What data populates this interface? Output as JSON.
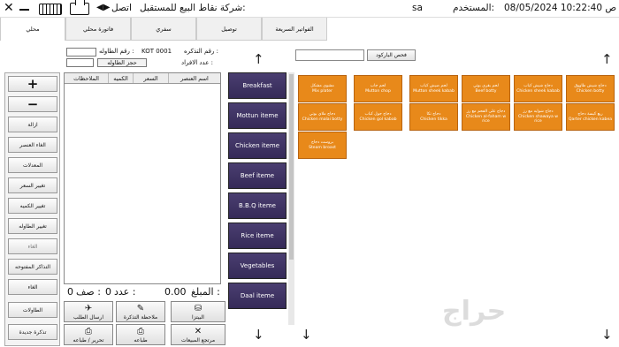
{
  "titlebar": {
    "company": "شركة نقاط البيع للمستقبل:",
    "connection": "اتصل",
    "user_label": "المستخدم:",
    "user_value": "sa",
    "datetime": "08/05/2024 10:22:40 ص",
    "close_glyph": "✕",
    "arrow_glyph": "◀▶"
  },
  "tabs": [
    {
      "label": "محلي"
    },
    {
      "label": "فاتورة محلي"
    },
    {
      "label": "سفري"
    },
    {
      "label": "توصيل"
    },
    {
      "label": "الفواتير السريعة"
    }
  ],
  "order": {
    "ticket_label": "رقم التذكره :",
    "ticket_value": "KOT 0001",
    "table_label": "رقم الطاوله :",
    "persons_label": "عدد الافراد :",
    "reserve_table": "حجز الطاوله"
  },
  "grid": {
    "columns": [
      "الملاحظات",
      "الكميه",
      "السعر",
      "اسم العنصر"
    ]
  },
  "summary": {
    "amount_label": "المبلغ :",
    "amount_value": "0.00",
    "count_label": "عدد :",
    "count_value": "0",
    "row_label": "صف :",
    "row_value": "0"
  },
  "left_buttons": [
    {
      "label": "+"
    },
    {
      "label": "−"
    },
    {
      "label": "ازالة"
    },
    {
      "label": "الغاء العنصر"
    },
    {
      "label": "المعدلات"
    },
    {
      "label": "تغيير السعر"
    },
    {
      "label": "تغيير الكميه"
    },
    {
      "label": "تغيير الطاوله"
    },
    {
      "label": "الغاء"
    },
    {
      "label": "التذاكر المفتوحه"
    },
    {
      "label": "الغاء"
    },
    {
      "label": "الطاولات"
    },
    {
      "label": "تذكرة جديدة"
    }
  ],
  "bottom_buttons": {
    "send_order": "ارسال الطلب",
    "ticket_note": "ملاحظة التذكرة",
    "pizza": "البيتزا",
    "edit_print": "تحرير / طباعه",
    "print": "طباعه",
    "sales_return": "مرتجع المبيعات"
  },
  "categories": [
    {
      "label": "Breakfast"
    },
    {
      "label": "Mottun iteme"
    },
    {
      "label": "Chicken iteme"
    },
    {
      "label": "Beef iteme"
    },
    {
      "label": "B.B.Q iteme"
    },
    {
      "label": "Rice iteme"
    },
    {
      "label": "Vegetables"
    },
    {
      "label": "Daal iteme"
    }
  ],
  "search": {
    "placeholder": "",
    "barcode_button": "فحص الباركود"
  },
  "items": [
    {
      "ar": "دجاج شيش طاووق",
      "en": "Chicken botty"
    },
    {
      "ar": "دجاج شيش كباب",
      "en": "Chicken sheek kabab"
    },
    {
      "ar": "لحم بقري بوتي",
      "en": "Beef botty"
    },
    {
      "ar": "لحم ضيش كباب",
      "en": "Mutton sheek kabab"
    },
    {
      "ar": "لحم جاب",
      "en": "Mutton chop"
    },
    {
      "ar": "مشوي مشكل",
      "en": "Mix plater"
    },
    {
      "ar": "ربع كيسة دجاج",
      "en": "Qarter chicken kabea"
    },
    {
      "ar": "دجاج شوايه مع رز",
      "en": "Chicken shawaya w rice"
    },
    {
      "ar": "دجاج على الفحم مع رز",
      "en": "Chicken al-faham w rice"
    },
    {
      "ar": "دجاج تكا",
      "en": "Chicken tikka"
    },
    {
      "ar": "دجاج جول كباب",
      "en": "Chicken gol kabab"
    },
    {
      "ar": "دجاج ملاي بوتي",
      "en": "Chicken malai botty"
    },
    {
      "ar": "بروست دجاج",
      "en": "Steam broast"
    }
  ],
  "watermark": "حراج"
}
